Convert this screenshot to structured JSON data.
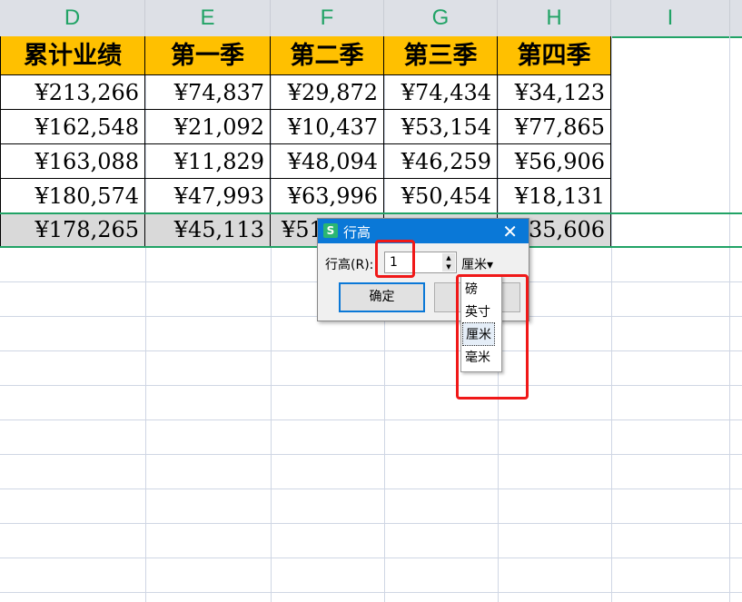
{
  "columns": [
    "D",
    "E",
    "F",
    "G",
    "H",
    "I"
  ],
  "table": {
    "headers": [
      "累计业绩",
      "第一季",
      "第二季",
      "第三季",
      "第四季"
    ],
    "rows": [
      [
        "¥213,266",
        "¥74,837",
        "¥29,872",
        "¥74,434",
        "¥34,123"
      ],
      [
        "¥162,548",
        "¥21,092",
        "¥10,437",
        "¥53,154",
        "¥77,865"
      ],
      [
        "¥163,088",
        "¥11,829",
        "¥48,094",
        "¥46,259",
        "¥56,906"
      ],
      [
        "¥180,574",
        "¥47,993",
        "¥63,996",
        "¥50,454",
        "¥18,131"
      ],
      [
        "¥178,265",
        "¥45,113",
        "¥51",
        "",
        "¥35,606"
      ]
    ]
  },
  "dialog": {
    "app_icon": "S",
    "title": "行高",
    "field_label": "行高(R):",
    "value": "1",
    "unit": "厘米",
    "ok_label": "确定",
    "unit_options": [
      "磅",
      "英寸",
      "厘米",
      "毫米"
    ],
    "selected_unit_index": 2
  }
}
